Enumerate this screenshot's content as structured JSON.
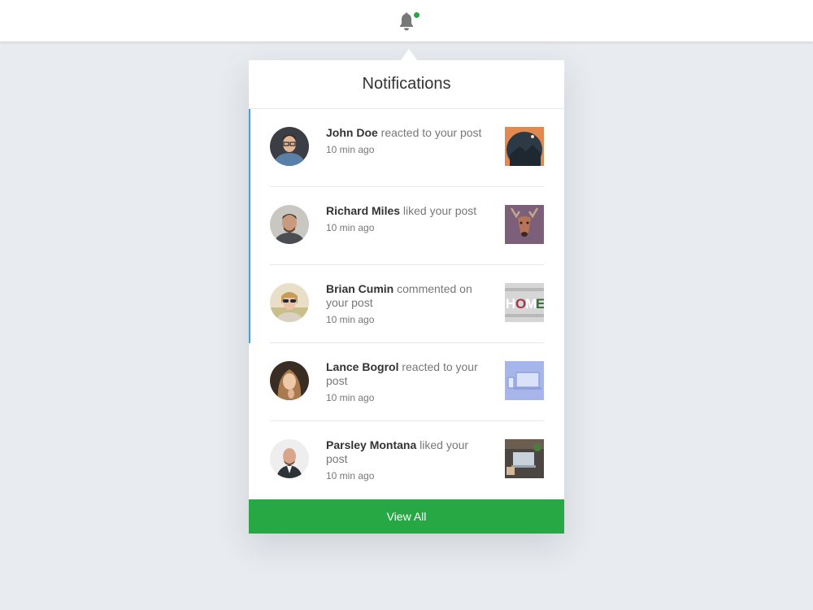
{
  "header": {
    "bell_icon": "bell-icon",
    "badge_color": "#28a745"
  },
  "panel": {
    "title": "Notifications",
    "accent_color": "#3ea2e0",
    "view_all_label": "View All",
    "view_all_color": "#28a745"
  },
  "notifications": [
    {
      "name": "John Doe",
      "action": "reacted to your post",
      "time": "10 min ago",
      "unread": true,
      "thumb": "mountain-photo"
    },
    {
      "name": "Richard Miles",
      "action": "liked your post",
      "time": "10 min ago",
      "unread": true,
      "thumb": "deer-photo"
    },
    {
      "name": "Brian Cumin",
      "action": "commented on your post",
      "time": "10 min ago",
      "unread": true,
      "thumb": "home-letters-photo"
    },
    {
      "name": "Lance Bogrol",
      "action": "reacted to your post",
      "time": "10 min ago",
      "unread": false,
      "thumb": "laptop-photo"
    },
    {
      "name": "Parsley Montana",
      "action": "liked your post",
      "time": "10 min ago",
      "unread": false,
      "thumb": "desk-photo"
    }
  ]
}
